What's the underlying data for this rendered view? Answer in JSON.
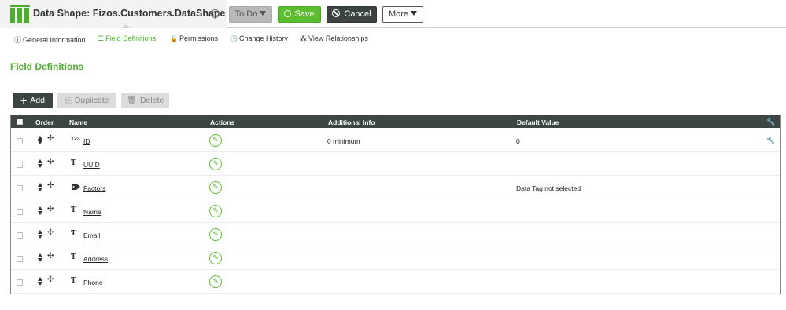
{
  "header": {
    "title": "Data Shape: Fizos.Customers.DataShape",
    "help_glyph": "?",
    "todo_label": "To Do",
    "save_label": "Save",
    "cancel_label": "Cancel",
    "more_label": "More"
  },
  "tabs": [
    {
      "label": "General Information",
      "icon": "info-icon",
      "glyph": "ⓘ"
    },
    {
      "label": "Field Definitions",
      "icon": "list-icon",
      "glyph": "☰"
    },
    {
      "label": "Permissions",
      "icon": "lock-icon",
      "glyph": "🔒"
    },
    {
      "label": "Change History",
      "icon": "clock-icon",
      "glyph": "🕒"
    },
    {
      "label": "View Relationships",
      "icon": "relationships-icon",
      "glyph": "⁂"
    }
  ],
  "section_title": "Field Definitions",
  "toolbar": {
    "add_label": "Add",
    "duplicate_label": "Duplicate",
    "delete_label": "Delete"
  },
  "table": {
    "columns": [
      "Order",
      "Name",
      "Actions",
      "Additional Info",
      "Default Value"
    ],
    "rows": [
      {
        "type": "123",
        "name": "ID",
        "additional_info": "0 minimum",
        "default_value": "0",
        "key": true
      },
      {
        "type": "T",
        "name": "UUID",
        "additional_info": "",
        "default_value": "",
        "key": false
      },
      {
        "type": "tag",
        "name": "Factors",
        "additional_info": "",
        "default_value": "Data Tag not selected",
        "key": false
      },
      {
        "type": "T",
        "name": "Name",
        "additional_info": "",
        "default_value": "",
        "key": false
      },
      {
        "type": "T",
        "name": "Email",
        "additional_info": "",
        "default_value": "",
        "key": false
      },
      {
        "type": "T",
        "name": "Address",
        "additional_info": "",
        "default_value": "",
        "key": false
      },
      {
        "type": "T",
        "name": "Phone",
        "additional_info": "",
        "default_value": "",
        "key": false
      }
    ]
  },
  "colors": {
    "brand_green": "#4caf2c",
    "header_dark": "#3d4644",
    "save_green": "#5bbd2f"
  }
}
